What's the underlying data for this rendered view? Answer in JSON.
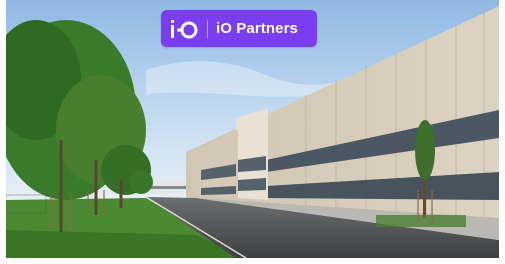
{
  "brand": {
    "name": "iO Partners",
    "mark": "i·O",
    "badge_color": "#7a3df0"
  },
  "scene": {
    "sky_color": "#cfe3f4",
    "facade_color": "#d8cdbb",
    "glass_color": "#4a5660",
    "grass_color": "#3f7a2a",
    "tree_color": "#2e6b22"
  }
}
